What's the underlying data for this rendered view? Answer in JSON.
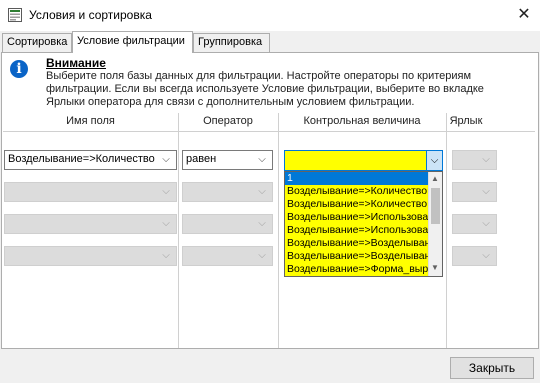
{
  "window": {
    "title": "Условия и сортировка",
    "close_glyph": "✕"
  },
  "tabs": [
    {
      "label": "Сортировка",
      "active": false
    },
    {
      "label": "Условие фильтрации",
      "active": true
    },
    {
      "label": "Группировка",
      "active": false
    }
  ],
  "info": {
    "title": "Внимание",
    "lines": [
      "Выберите поля базы данных для фильтрации. Настройте операторы по критериям",
      "фильтрации. Если вы всегда используете Условие фильтрации, выберите во вкладке",
      "Ярлыки оператора для связи с дополнительным условием фильтрации."
    ]
  },
  "grid": {
    "columns": [
      "Имя поля",
      "Оператор",
      "Контрольная величина",
      "Ярлык"
    ],
    "row1": {
      "field": "Возделывание=>Количество",
      "operator": "равен",
      "value": ""
    },
    "arrow_glyph": "⌵"
  },
  "dropdown": {
    "items": [
      "1",
      "Возделывание=>Количество",
      "Возделывание=>Количество",
      "Возделывание=>Использова",
      "Возделывание=>Использова",
      "Возделывание=>Возделыван",
      "Возделывание=>Возделыван",
      "Возделывание=>Форма_выр"
    ],
    "selected_index": 0
  },
  "footer": {
    "close_label": "Закрыть"
  },
  "colors": {
    "highlight": "#ffff00",
    "selection": "#0078d7",
    "info_icon": "#0a64c7"
  }
}
